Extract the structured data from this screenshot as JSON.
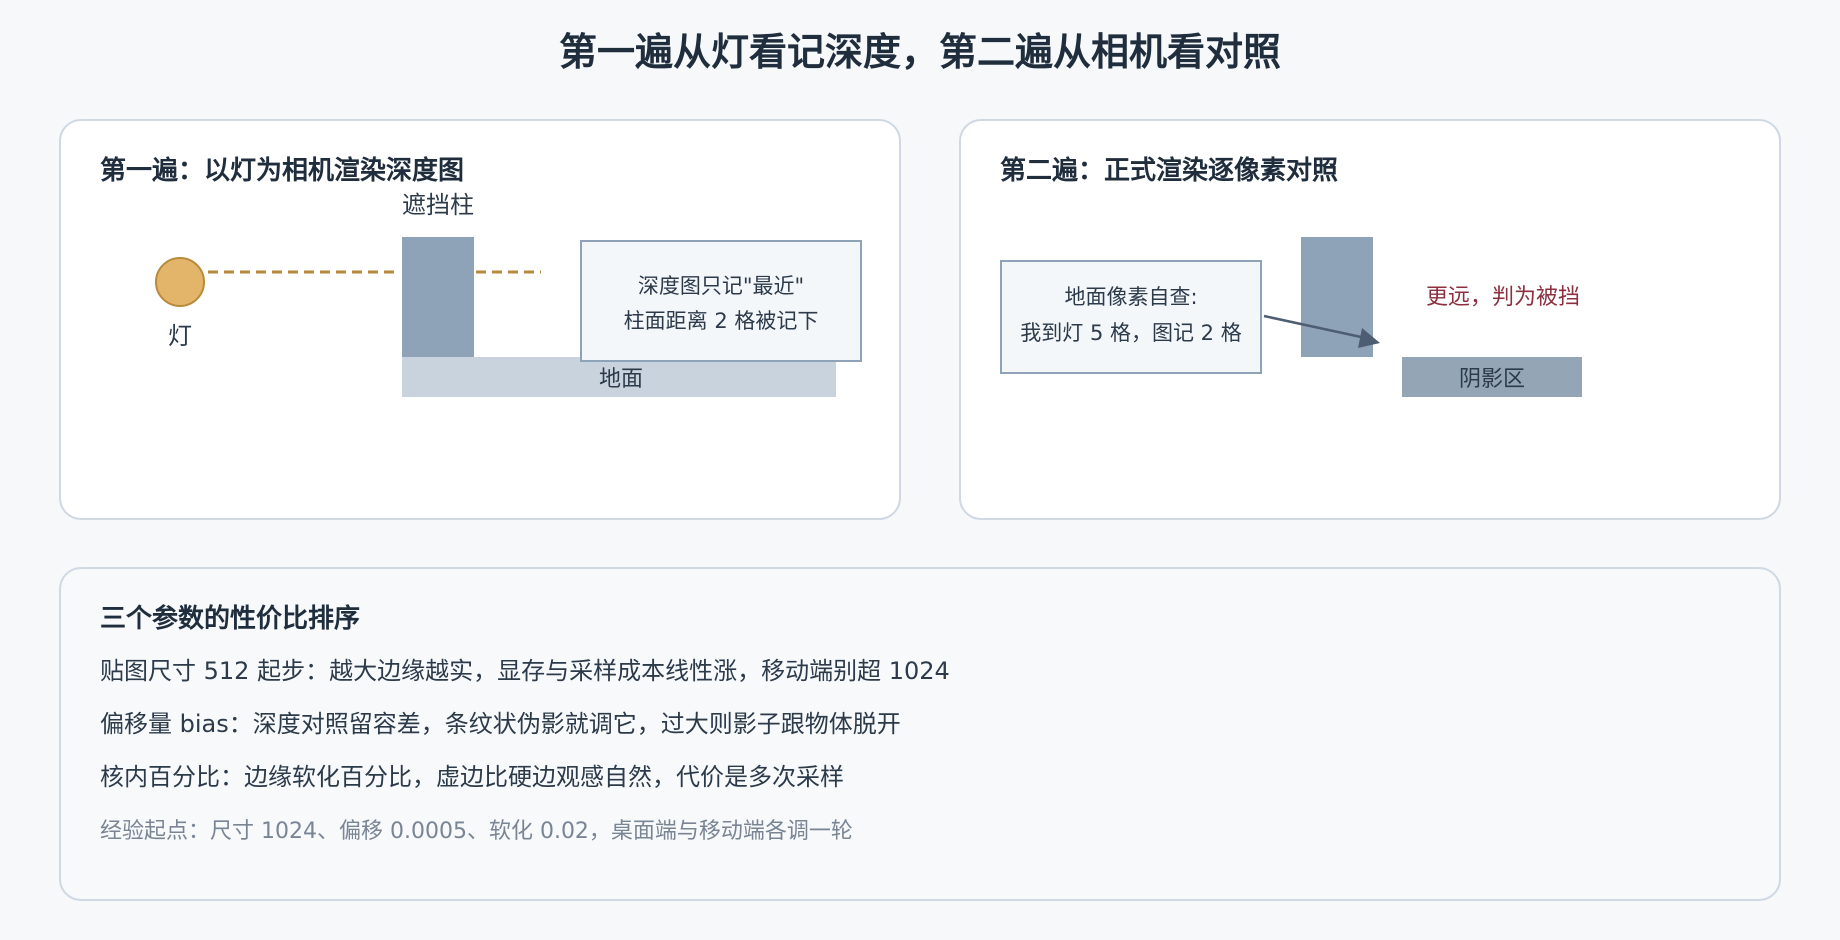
{
  "title": "第一遍从灯看记深度，第二遍从相机看对照",
  "pass1": {
    "heading": "第一遍：以灯为相机渲染深度图",
    "light_label": "灯",
    "pillar_label": "遮挡柱",
    "ground_label": "地面",
    "note_line1": "深度图只记\"最近\"",
    "note_line2": "柱面距离 2 格被记下"
  },
  "pass2": {
    "heading": "第二遍：正式渲染逐像素对照",
    "check_line1": "地面像素自查:",
    "check_line2": "我到灯 5 格，图记 2 格",
    "verdict": "更远，判为被挡",
    "shadow_label": "阴影区"
  },
  "params": {
    "heading": "三个参数的性价比排序",
    "items": [
      "贴图尺寸 512 起步：越大边缘越实，显存与采样成本线性涨，移动端别超 1024",
      "偏移量 bias：深度对照留容差，条纹状伪影就调它，过大则影子跟物体脱开",
      "核内百分比：边缘软化百分比，虚边比硬边观感自然，代价是多次采样"
    ],
    "tip": "经验起点：尺寸 1024、偏移 0.0005、软化 0.02，桌面端与移动端各调一轮"
  },
  "colors": {
    "light_fill": "#e2b56b",
    "light_stroke": "#b88a3a",
    "ray": "#b58a3c",
    "pillar": "#8fa3b8",
    "ground": "#c8d3dd",
    "shadow": "#94a6b6",
    "note_fill": "#f4f7f9",
    "note_stroke": "#8fa3b8",
    "arrow": "#4d5e73",
    "verdict": "#8c2f3f"
  }
}
